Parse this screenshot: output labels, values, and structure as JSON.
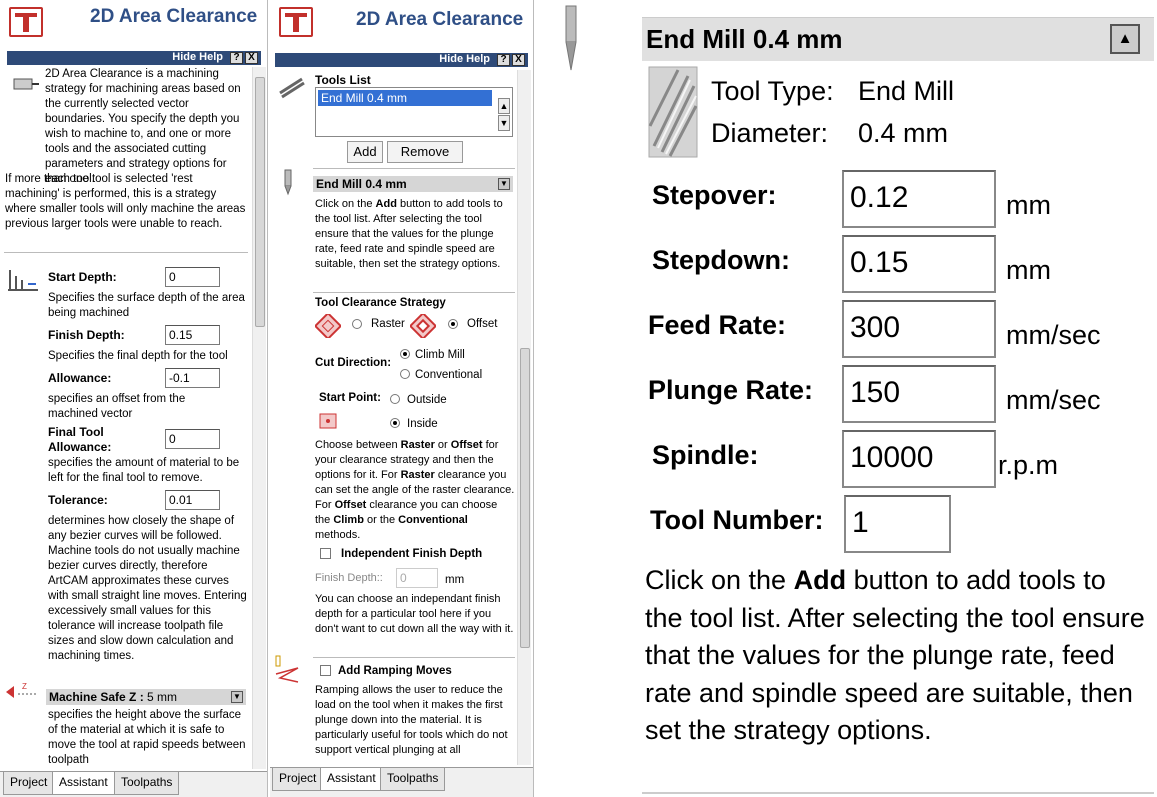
{
  "app_title": "2D Area Clearance",
  "hide_help": "Hide Help",
  "help_q": "?",
  "help_x": "X",
  "p1": {
    "intro": "2D Area Clearance is a machining strategy for machining areas based on the currently selected vector boundaries. You specify the depth you wish to machine to, and one or more tools and the associated cutting parameters and strategy options for each tool.",
    "intro2": "If more than one tool is selected 'rest machining' is performed, this is a strategy where smaller tools will only machine the areas previous larger tools were unable to reach.",
    "start_depth_label": "Start Depth:",
    "start_depth": "0",
    "start_depth_help": "Specifies the surface depth of the area being machined",
    "finish_depth_label": "Finish Depth:",
    "finish_depth": "0.15",
    "finish_depth_help": "Specifies the final depth for the tool",
    "allowance_label": "Allowance:",
    "allowance": "-0.1",
    "allowance_help": "specifies an offset from the machined vector",
    "final_allow_label": "Final Tool Allowance:",
    "final_allow": "0",
    "final_allow_help": "specifies the amount of material to be left for the final tool to remove.",
    "tolerance_label": "Tolerance:",
    "tolerance": "0.01",
    "tolerance_help": "determines how closely the shape of any bezier curves will be followed. Machine tools do not usually machine bezier curves directly, therefore ArtCAM approximates these curves with small straight line moves. Entering excessively small values for this tolerance will increase toolpath file sizes and slow down calculation and machining times.",
    "safe_z_label": "Machine Safe Z :",
    "safe_z_value": "5 mm",
    "safe_z_help": "specifies the height above the surface of the material at which it is safe to move the tool at rapid speeds between toolpath"
  },
  "p2": {
    "tools_list_label": "Tools List",
    "tools": [
      "End Mill 0.4 mm"
    ],
    "add": "Add",
    "remove": "Remove",
    "tool_header": "End Mill 0.4 mm",
    "tool_help_a": "Click on the ",
    "tool_help_b": "Add",
    "tool_help_c": " button to add tools to the tool list. After selecting the tool ensure that the values for the plunge rate, feed rate and spindle speed are suitable, then set the strategy options.",
    "strategy_label": "Tool Clearance Strategy",
    "raster": "Raster",
    "offset": "Offset",
    "cut_dir_label": "Cut Direction:",
    "climb": "Climb Mill",
    "conventional": "Conventional",
    "start_point_label": "Start Point:",
    "outside": "Outside",
    "inside": "Inside",
    "choose_a": "Choose between ",
    "choose_b": "Raster",
    "choose_c": " or ",
    "choose_d": "Offset",
    "choose_e": " for your clearance strategy and then the options for it. For ",
    "choose_f": "Raster",
    "choose_g": " clearance you can set the angle of the raster clearance. For ",
    "choose_h": "Offset",
    "choose_i": " clearance you can choose the ",
    "choose_j": "Climb",
    "choose_k": " or the ",
    "choose_l": "Conventional",
    "choose_m": " methods.",
    "indep_label": "Independent Finish Depth",
    "finish_depth_label": "Finish Depth::",
    "finish_depth": "0",
    "finish_unit": "mm",
    "indep_help": "You can choose an independant finish depth for a particular tool here if you don't want to cut down all the way with it.",
    "ramp_label": "Add Ramping Moves",
    "ramp_help": "Ramping allows the user to reduce the load on the tool when it makes the first plunge down into the material. It is particularly useful for tools which do not support vertical plunging at all"
  },
  "tabs": [
    "Project",
    "Assistant",
    "Toolpaths"
  ],
  "p3": {
    "header": "End Mill 0.4 mm",
    "tool_type_label": "Tool Type:",
    "tool_type": "End Mill",
    "diameter_label": "Diameter:",
    "diameter": "0.4 mm",
    "stepover_label": "Stepover:",
    "stepover": "0.12",
    "stepover_unit": "mm",
    "stepdown_label": "Stepdown:",
    "stepdown": "0.15",
    "stepdown_unit": "mm",
    "feed_label": "Feed Rate:",
    "feed": "300",
    "feed_unit": "mm/sec",
    "plunge_label": "Plunge Rate:",
    "plunge": "150",
    "plunge_unit": "mm/sec",
    "spindle_label": "Spindle:",
    "spindle": "10000",
    "spindle_unit": "r.p.m",
    "toolnum_label": "Tool Number:",
    "toolnum": "1",
    "help_a": "Click on the ",
    "help_b": "Add",
    "help_c": " button to add tools to the tool list. After selecting the tool ensure that the values for the plunge rate, feed rate and spindle speed are suitable, then set the strategy options."
  }
}
